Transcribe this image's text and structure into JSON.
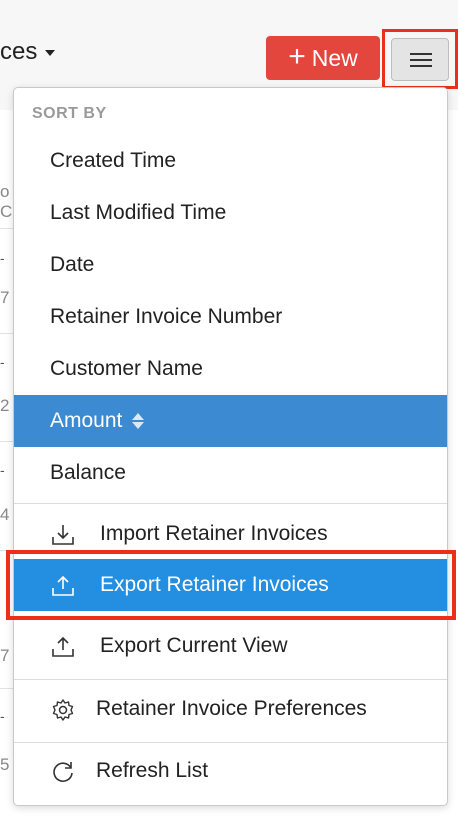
{
  "header": {
    "view_title_fragment": "ces",
    "new_button_label": "New",
    "new_button_color": "#e2463c"
  },
  "background_list": {
    "row_fragments": [
      "7",
      "2",
      "4",
      "7",
      "5"
    ],
    "partial_header": "o C"
  },
  "dropdown": {
    "sort_heading": "SORT BY",
    "sort_options": [
      {
        "label": "Created Time",
        "active": false
      },
      {
        "label": "Last Modified Time",
        "active": false
      },
      {
        "label": "Date",
        "active": false
      },
      {
        "label": "Retainer Invoice Number",
        "active": false
      },
      {
        "label": "Customer Name",
        "active": false
      },
      {
        "label": "Amount",
        "active": true
      },
      {
        "label": "Balance",
        "active": false
      }
    ],
    "actions": [
      {
        "label": "Import Retainer Invoices",
        "icon": "import-icon"
      },
      {
        "label": "Export Retainer Invoices",
        "icon": "export-icon",
        "active": true
      },
      {
        "label": "Export Current View",
        "icon": "export-view-icon"
      },
      {
        "label": "Retainer Invoice Preferences",
        "icon": "gear-icon"
      },
      {
        "label": "Refresh List",
        "icon": "refresh-icon"
      }
    ]
  },
  "colors": {
    "sort_active": "#3b8ad2",
    "action_active": "#248fe0",
    "highlight_border": "#ec2f18"
  }
}
